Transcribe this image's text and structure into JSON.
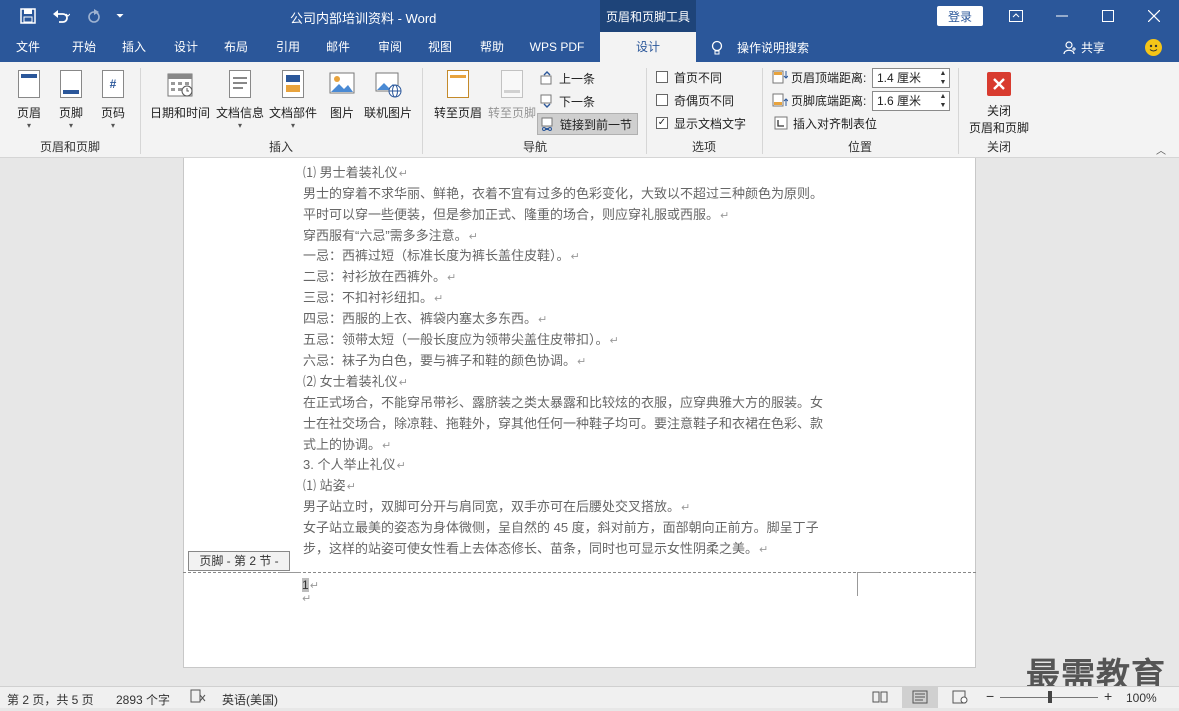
{
  "title_bar": {
    "document_title": "公司内部培训资料  -  Word",
    "tool_tab": "页眉和页脚工具",
    "login": "登录",
    "save_icon": "save-icon",
    "undo_icon": "undo-icon",
    "redo_icon": "redo-icon",
    "customize_icon": "customize-quick-access-icon"
  },
  "menu_tabs": [
    "文件",
    "开始",
    "插入",
    "设计",
    "布局",
    "引用",
    "邮件",
    "审阅",
    "视图",
    "帮助",
    "WPS PDF",
    "设计"
  ],
  "active_tab_index": 11,
  "tell_me": "操作说明搜索",
  "share": "共享",
  "ribbon": {
    "group_header_footer": {
      "label": "页眉和页脚",
      "buttons": [
        "页眉",
        "页脚",
        "页码"
      ]
    },
    "group_insert": {
      "label": "插入",
      "buttons": [
        "日期和时间",
        "文档信息",
        "文档部件",
        "图片",
        "联机图片"
      ]
    },
    "group_navigation": {
      "label": "导航",
      "goto_header": "转至页眉",
      "goto_footer": "转至页脚",
      "prev": "上一条",
      "next": "下一条",
      "link_prev": "链接到前一节"
    },
    "group_options": {
      "label": "选项",
      "diff_first": "首页不同",
      "diff_odd_even": "奇偶页不同",
      "show_doc_text": "显示文档文字",
      "diff_first_checked": false,
      "diff_odd_even_checked": false,
      "show_doc_text_checked": true
    },
    "group_position": {
      "label": "位置",
      "header_from_top_label": "页眉顶端距离:",
      "header_from_top_value": "1.4 厘米",
      "footer_from_bottom_label": "页脚底端距离:",
      "footer_from_bottom_value": "1.6 厘米",
      "insert_align_tab": "插入对齐制表位"
    },
    "group_close": {
      "label": "关闭",
      "close_line1": "关闭",
      "close_line2": "页眉和页脚"
    }
  },
  "document_lines": [
    "⑴ 男士着装礼仪",
    "男士的穿着不求华丽、鲜艳，衣着不宜有过多的色彩变化，大致以不超过三种颜色为原则。",
    "平时可以穿一些便装，但是参加正式、隆重的场合，则应穿礼服或西服。",
    "穿西服有“六忌”需多多注意。",
    "一忌：西裤过短（标准长度为裤长盖住皮鞋）。",
    "二忌：衬衫放在西裤外。",
    "三忌：不扣衬衫纽扣。",
    "四忌：西服的上衣、裤袋内塞太多东西。",
    "五忌：领带太短（一般长度应为领带尖盖住皮带扣）。",
    "六忌：袜子为白色，要与裤子和鞋的颜色协调。",
    "⑵ 女士着装礼仪",
    "在正式场合，不能穿吊带衫、露脐装之类太暴露和比较炫的衣服，应穿典雅大方的服装。女",
    "士在社交场合，除凉鞋、拖鞋外，穿其他任何一种鞋子均可。要注意鞋子和衣裙在色彩、款",
    "式上的协调。",
    "3. 个人举止礼仪",
    "⑴ 站姿",
    "男子站立时，双脚可分开与肩同宽，双手亦可在后腰处交叉搭放。",
    "女子站立最美的姿态为身体微侧，呈自然的 45 度，斜对前方，面部朝向正前方。脚呈丁子",
    "步，这样的站姿可使女性看上去体态修长、苗条，同时也可显示女性阴柔之美。"
  ],
  "line_has_return": [
    true,
    false,
    true,
    true,
    true,
    true,
    true,
    true,
    true,
    true,
    true,
    false,
    false,
    true,
    true,
    true,
    true,
    false,
    true
  ],
  "footer_tag": "页脚 - 第 2 节 -",
  "footer_page_number": "1",
  "status_bar": {
    "page_info": "第 2 页，共 5 页",
    "word_count": "2893 个字",
    "language": "英语(美国)",
    "zoom": "100%"
  },
  "watermark": "最需教育",
  "colors": {
    "accent": "#2b579a",
    "close_button": "#d83b2f"
  }
}
